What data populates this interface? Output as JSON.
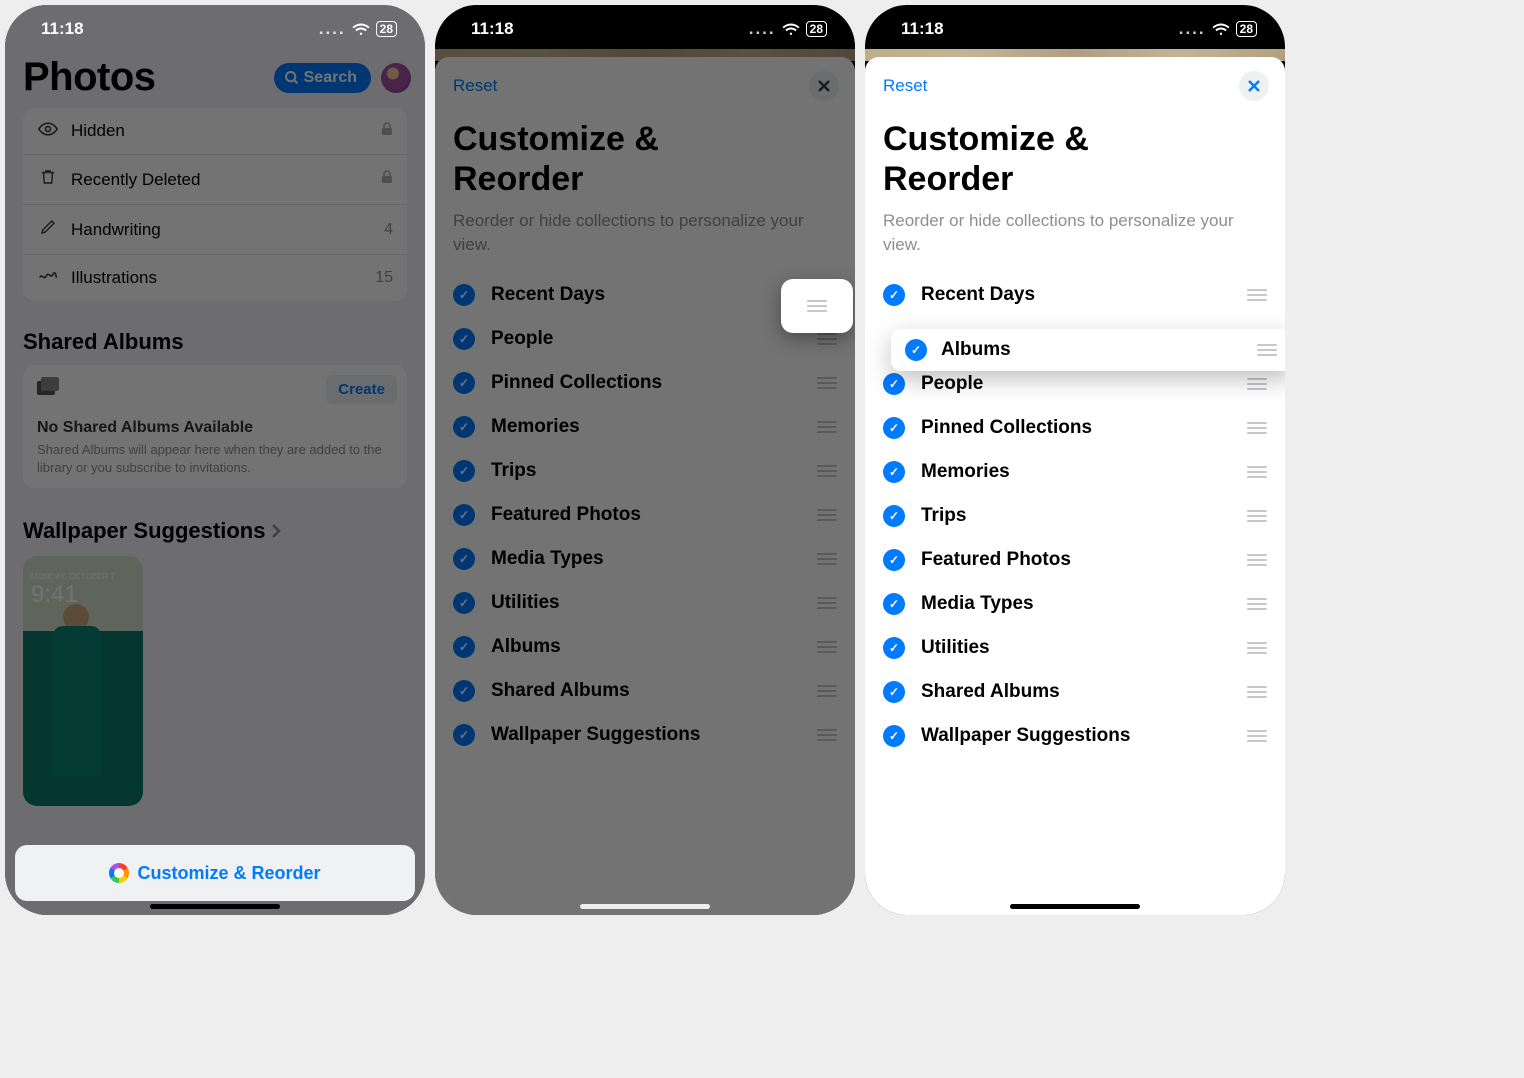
{
  "status": {
    "time": "11:18",
    "battery": "28",
    "cell_dots": "....",
    "wifi": "📶"
  },
  "screen1": {
    "app_title": "Photos",
    "search_label": "Search",
    "rows": {
      "hidden": {
        "label": "Hidden",
        "meta_icon": "lock"
      },
      "deleted": {
        "label": "Recently Deleted",
        "meta_icon": "lock"
      },
      "handwriting": {
        "label": "Handwriting",
        "meta": "4"
      },
      "illustrations": {
        "label": "Illustrations",
        "meta": "15"
      }
    },
    "shared_header": "Shared Albums",
    "create_label": "Create",
    "shared_empty_title": "No Shared Albums Available",
    "shared_empty_sub": "Shared Albums will appear here when they are added to the library or you subscribe to invitations.",
    "wallpaper_header": "Wallpaper Suggestions",
    "wallpaper_clock": "9:41",
    "customize_label": "Customize & Reorder"
  },
  "sheet": {
    "reset": "Reset",
    "title1": "Customize &",
    "title2": "Reorder",
    "subtitle": "Reorder or hide collections to personalize your view."
  },
  "list2": [
    "Recent Days",
    "People",
    "Pinned Collections",
    "Memories",
    "Trips",
    "Featured Photos",
    "Media Types",
    "Utilities",
    "Albums",
    "Shared Albums",
    "Wallpaper Suggestions"
  ],
  "list3": {
    "static": [
      "Recent Days"
    ],
    "dragging": "Albums",
    "rest": [
      "People",
      "Pinned Collections",
      "Memories",
      "Trips",
      "Featured Photos",
      "Media Types",
      "Utilities",
      "Shared Albums",
      "Wallpaper Suggestions"
    ]
  }
}
